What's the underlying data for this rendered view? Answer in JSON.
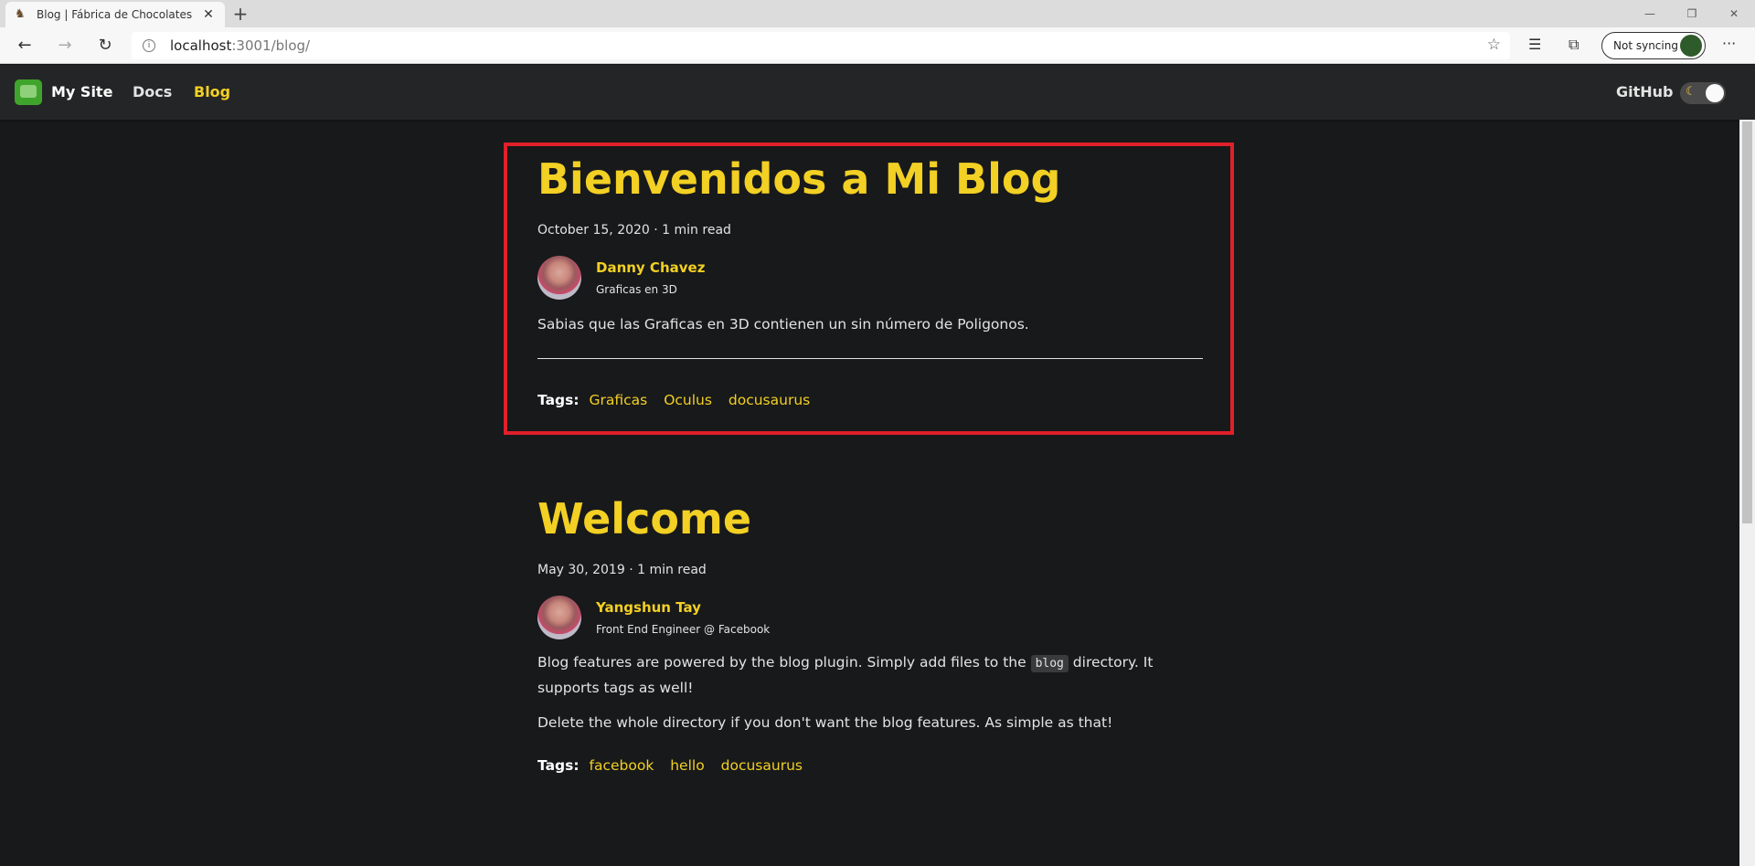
{
  "browser": {
    "tab_title": "Blog | Fábrica de Chocolates",
    "new_tab": "+",
    "close": "✕",
    "url_host": "localhost",
    "url_path": ":3001/blog/",
    "sync_label": "Not syncing",
    "minimize": "—",
    "restore": "❐",
    "window_close": "✕"
  },
  "navbar": {
    "site_title": "My Site",
    "links": [
      {
        "label": "Docs",
        "active": false
      },
      {
        "label": "Blog",
        "active": true
      }
    ],
    "github": "GitHub"
  },
  "posts": [
    {
      "title": "Bienvenidos a Mi Blog",
      "meta": "October 15, 2020 · 1 min read",
      "author_name": "Danny Chavez",
      "author_title": "Graficas en 3D",
      "paragraphs": [
        "Sabias que las Graficas en 3D contienen un sin número de Poligonos."
      ],
      "tags_label": "Tags:",
      "tags": [
        "Graficas",
        "Oculus",
        "docusaurus"
      ]
    },
    {
      "title": "Welcome",
      "meta": "May 30, 2019 · 1 min read",
      "author_name": "Yangshun Tay",
      "author_title": "Front End Engineer @ Facebook",
      "paragraph1_before": "Blog features are powered by the blog plugin. Simply add files to the ",
      "paragraph1_code": "blog",
      "paragraph1_after": " directory. It supports tags as well!",
      "paragraph2": "Delete the whole directory if you don't want the blog features. As simple as that!",
      "tags_label": "Tags:",
      "tags": [
        "facebook",
        "hello",
        "docusaurus"
      ]
    }
  ],
  "colors": {
    "accent": "#f2d024",
    "background": "#18191a",
    "navbar": "#242526",
    "highlight": "#e0202a"
  }
}
